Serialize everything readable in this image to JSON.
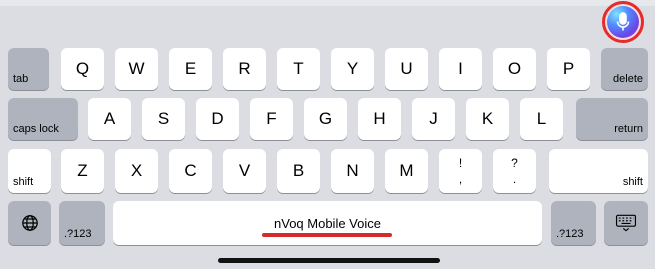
{
  "keyboard": {
    "row1": [
      "Q",
      "W",
      "E",
      "R",
      "T",
      "Y",
      "U",
      "I",
      "O",
      "P"
    ],
    "row2": [
      "A",
      "S",
      "D",
      "F",
      "G",
      "H",
      "J",
      "K",
      "L"
    ],
    "row3": [
      "Z",
      "X",
      "C",
      "V",
      "B",
      "N",
      "M"
    ],
    "tab_label": "tab",
    "delete_label": "delete",
    "caps_label": "caps lock",
    "return_label": "return",
    "shift_label": "shift",
    "shift_right_label": "shift",
    "excl_top": "!",
    "excl_bottom": ",",
    "question_top": "?",
    "question_bottom": ".",
    "numbers_left_label": ".?123",
    "numbers_right_label": ".?123",
    "space_label": "nVoq Mobile Voice"
  },
  "icons": {
    "globe": "globe-icon",
    "keyboard_dismiss": "keyboard-dismiss-icon",
    "microphone": "microphone-icon"
  },
  "colors": {
    "key": "#ffffff",
    "dark_key": "#aeb3bd",
    "background": "#dcdde2",
    "highlight": "#e52b2b"
  }
}
